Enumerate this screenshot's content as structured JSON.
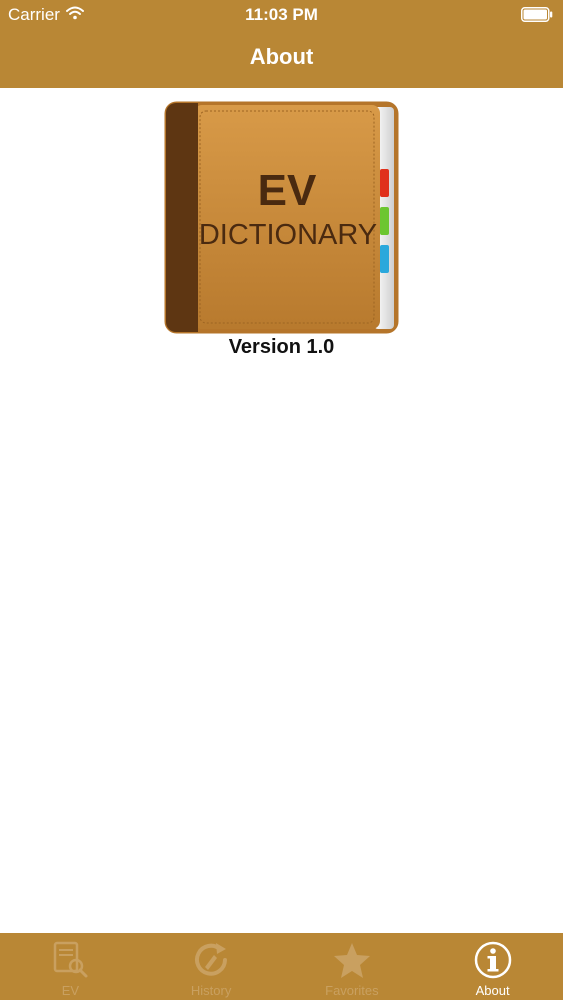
{
  "status_bar": {
    "carrier": "Carrier",
    "time": "11:03 PM"
  },
  "nav": {
    "title": "About"
  },
  "app_icon": {
    "brand_line1": "EV",
    "brand_line2": "DICTIONARY",
    "cover_color": "#c88a3a",
    "spine_color": "#5e3612",
    "tab_colors": [
      "#e0301c",
      "#6cc630",
      "#2aa8dc"
    ]
  },
  "about": {
    "version_text": "Version 1.0"
  },
  "tabbar": {
    "tabs": [
      {
        "label": "EV",
        "icon": "dictionary-search-icon",
        "active": false
      },
      {
        "label": "History",
        "icon": "history-icon",
        "active": false
      },
      {
        "label": "Favorites",
        "icon": "star-icon",
        "active": false
      },
      {
        "label": "About",
        "icon": "info-icon",
        "active": true
      }
    ]
  },
  "colors": {
    "accent": "#b98735",
    "inactive_tab": "#c9a060",
    "active_tab": "#ffffff"
  }
}
